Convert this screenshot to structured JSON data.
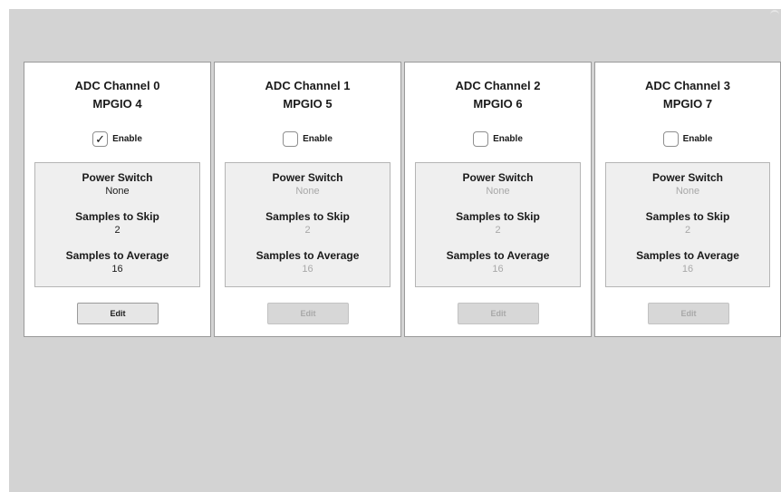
{
  "channels": [
    {
      "title": "ADC Channel 0",
      "subtitle": "MPGIO 4",
      "enabled": true,
      "enable_label": "Enable",
      "check": "✓",
      "power_label": "Power Switch",
      "power_value": "None",
      "skip_label": "Samples to Skip",
      "skip_value": "2",
      "avg_label": "Samples to Average",
      "avg_value": "16",
      "edit_label": "Edit"
    },
    {
      "title": "ADC Channel 1",
      "subtitle": "MPGIO 5",
      "enabled": false,
      "enable_label": "Enable",
      "check": "",
      "power_label": "Power Switch",
      "power_value": "None",
      "skip_label": "Samples to Skip",
      "skip_value": "2",
      "avg_label": "Samples to Average",
      "avg_value": "16",
      "edit_label": "Edit"
    },
    {
      "title": "ADC Channel 2",
      "subtitle": "MPGIO 6",
      "enabled": false,
      "enable_label": "Enable",
      "check": "",
      "power_label": "Power Switch",
      "power_value": "None",
      "skip_label": "Samples to Skip",
      "skip_value": "2",
      "avg_label": "Samples to Average",
      "avg_value": "16",
      "edit_label": "Edit"
    },
    {
      "title": "ADC Channel 3",
      "subtitle": "MPGIO 7",
      "enabled": false,
      "enable_label": "Enable",
      "check": "",
      "power_label": "Power Switch",
      "power_value": "None",
      "skip_label": "Samples to Skip",
      "skip_value": "2",
      "avg_label": "Samples to Average",
      "avg_value": "16",
      "edit_label": "Edit"
    }
  ],
  "colors": {
    "background": "#d3d3d3",
    "card": "#ffffff",
    "settings_panel": "#efefef",
    "disabled_text": "#a8a8a8"
  },
  "icons": {
    "checkmark": "check-icon"
  }
}
